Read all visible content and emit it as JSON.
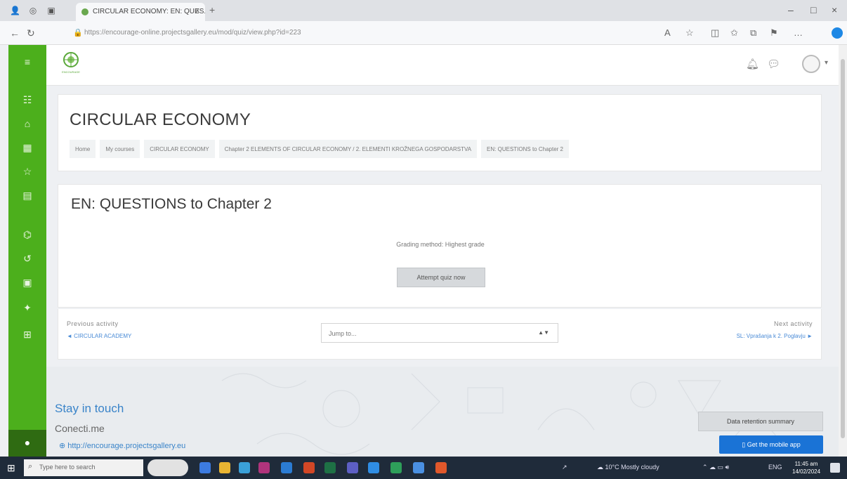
{
  "browser": {
    "tab_title": "CIRCULAR ECONOMY: EN: QUES...",
    "tab_close": "x",
    "new_tab": "+",
    "url": "https://encourage-online.projectsgallery.eu/mod/quiz/view.php?id=223",
    "window_controls": [
      "–",
      "□",
      "×"
    ]
  },
  "navbar": {
    "logo_caption": "ENCOURAGE"
  },
  "header": {
    "course_title": "CIRCULAR ECONOMY",
    "breadcrumbs": [
      "Home",
      "My courses",
      "CIRCULAR ECONOMY",
      "Chapter 2 ELEMENTS OF CIRCULAR ECONOMY / 2. ELEMENTI KROŽNEGA GOSPODARSTVA",
      "EN: QUESTIONS to Chapter 2"
    ]
  },
  "quiz": {
    "title": "EN: QUESTIONS to Chapter 2",
    "grading_method": "Grading method: Highest grade",
    "attempt_button": "Attempt quiz now"
  },
  "activity_nav": {
    "previous_label": "Previous activity",
    "previous_link": "◄ CIRCULAR ACADEMY",
    "jump_placeholder": "Jump to...",
    "next_label": "Next activity",
    "next_link": "SL: Vprašanja k 2. Poglavju ►"
  },
  "footer": {
    "stay_in_touch": "Stay in touch",
    "connect": "Conecti.me",
    "link": "http://encourage.projectsgallery.eu",
    "data_retention": "Data retention summary",
    "mobile_app": "Get the mobile app"
  },
  "taskbar": {
    "search_placeholder": "Type here to search",
    "weather": "10°C Mostly cloudy",
    "language": "ENG",
    "time": "11:45 am",
    "date": "14/02/2024"
  },
  "colors": {
    "drawer_green": "#4caf1c",
    "link_blue": "#3a84c9",
    "button_blue": "#1a73d6"
  },
  "icons": {
    "drawer": [
      "menu-icon",
      "dashboard-icon",
      "home-icon",
      "calendar-icon",
      "star-icon",
      "book-icon",
      "school-icon",
      "history-icon",
      "briefcase-icon",
      "lightbulb-icon",
      "grid-icon"
    ],
    "navbar": [
      "bell-icon",
      "chat-icon",
      "user-avatar-icon"
    ]
  }
}
